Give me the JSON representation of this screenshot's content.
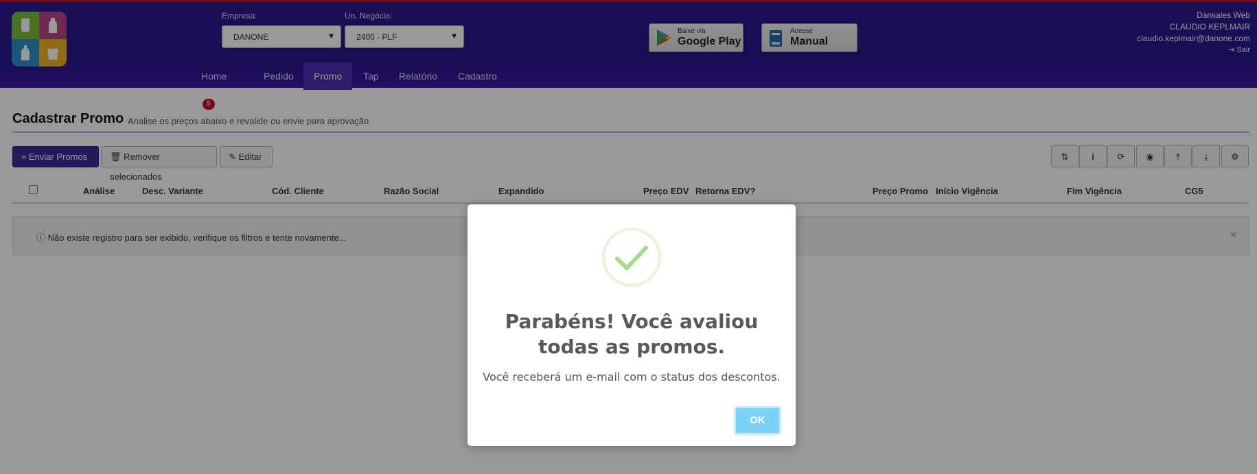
{
  "header": {
    "empresa_label": "Empresa:",
    "empresa_value": "DANONE",
    "un_negocio_label": "Un. Negócio:",
    "un_negocio_value": "2400 - PLF",
    "google_play": {
      "small": "Baixe via",
      "big": "Google Play"
    },
    "manual": {
      "small": "Acesse",
      "big": "Manual"
    },
    "user": {
      "app_name": "Dansales Web",
      "name": "CLAUDIO KEPLMAIR",
      "email": "claudio.keplmair@danone.com",
      "logout": "Sair"
    },
    "accent_color": "#2a1a8c",
    "badge_color": "#c8102e"
  },
  "nav": {
    "items": [
      {
        "label": "Home",
        "badge": "5"
      },
      {
        "label": "Pedido"
      },
      {
        "label": "Promo",
        "active": true
      },
      {
        "label": "Tap"
      },
      {
        "label": "Relatório"
      },
      {
        "label": "Cadastro"
      }
    ]
  },
  "page": {
    "title": "Cadastrar Promo",
    "subtitle": "Analise os preços abaixo e revalide ou envie para aprovação"
  },
  "toolbar": {
    "send_label": "Enviar Promos",
    "remove_label": "Remover selecionados",
    "edit_label": "Editar",
    "icon_buttons": [
      "sort-icon",
      "info-icon",
      "refresh-icon",
      "binoculars-icon",
      "upload-icon",
      "download-icon",
      "gear-icon"
    ]
  },
  "table": {
    "columns": [
      "Análise",
      "Desc. Variante",
      "Cód. Cliente",
      "Razão Social",
      "Expandido",
      "Preço EDV",
      "Retorna EDV?",
      "Preço Promo",
      "Início Vigência",
      "Fim Vigência",
      "CG5"
    ],
    "empty_message": "Não existe registro para ser exibido, verifique os filtros e tente novamente..."
  },
  "modal": {
    "title": "Parabéns! Você avaliou todas as promos.",
    "text": "Você receberá um e-mail com o status dos descontos.",
    "ok_label": "OK",
    "icon": "success-check-icon",
    "ok_color": "#7cd1f9"
  }
}
